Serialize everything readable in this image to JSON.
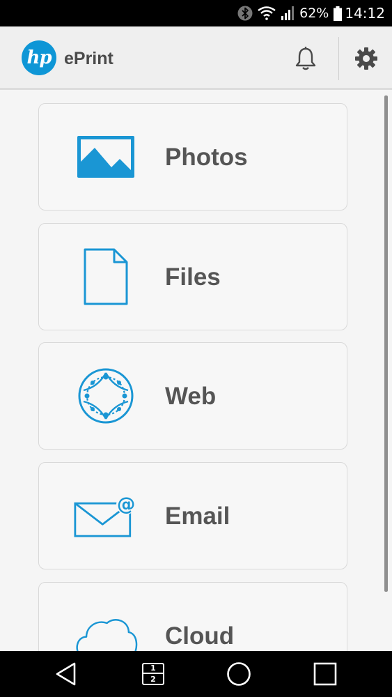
{
  "status_bar": {
    "battery_percent": "62%",
    "time": "14:12",
    "icons": [
      "bluetooth-icon",
      "wifi-icon",
      "signal-icon",
      "battery-icon"
    ]
  },
  "header": {
    "logo_text": "hp",
    "title": "ePrint",
    "icons": [
      "bell-icon",
      "gear-icon"
    ],
    "brand_color": "#0e96d6"
  },
  "menu": {
    "items": [
      {
        "label": "Photos",
        "icon": "photo-icon"
      },
      {
        "label": "Files",
        "icon": "file-icon"
      },
      {
        "label": "Web",
        "icon": "web-icon"
      },
      {
        "label": "Email",
        "icon": "email-icon"
      },
      {
        "label": "Cloud",
        "icon": "cloud-icon"
      }
    ],
    "icon_color": "#1a96d4"
  },
  "nav_bar": {
    "multiwindow_top": "1",
    "multiwindow_bottom": "2",
    "icons": [
      "back-icon",
      "multiwindow-icon",
      "home-icon",
      "recents-icon"
    ]
  }
}
